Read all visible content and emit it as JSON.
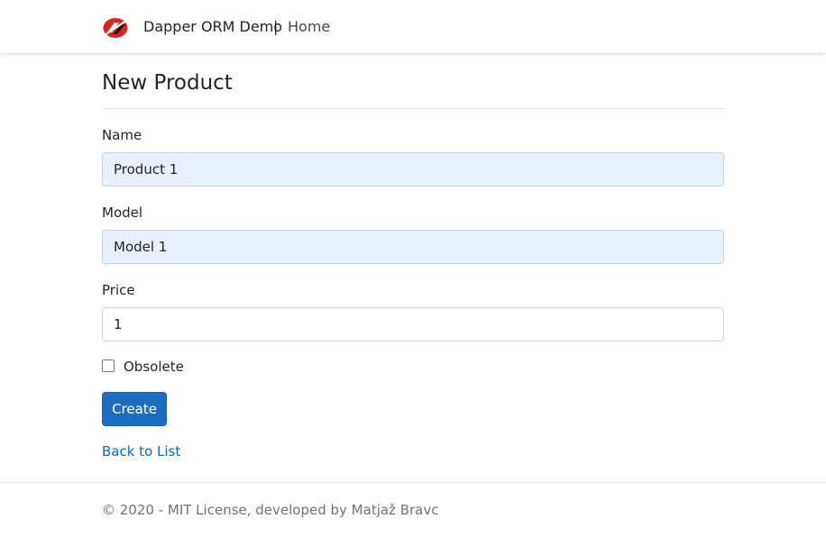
{
  "navbar": {
    "logo_icon": "app-logo-icon",
    "brand": "Dapper ORM Demo",
    "separator": "|",
    "home_link": "Home"
  },
  "main": {
    "title": "New Product",
    "fields": {
      "name": {
        "label": "Name",
        "value": "Product 1"
      },
      "model": {
        "label": "Model",
        "value": "Model 1"
      },
      "price": {
        "label": "Price",
        "value": "1"
      }
    },
    "obsolete": {
      "label": "Obsolete",
      "checked": false
    },
    "create_button": "Create",
    "back_link": "Back to List"
  },
  "footer": {
    "text": "© 2020 - MIT License, developed by Matjaž Bravc"
  },
  "colors": {
    "primary_button": "#1b6ec2",
    "link": "#0366d6",
    "autofill_bg": "#e8f0fe",
    "logo_red": "#d9261c"
  }
}
